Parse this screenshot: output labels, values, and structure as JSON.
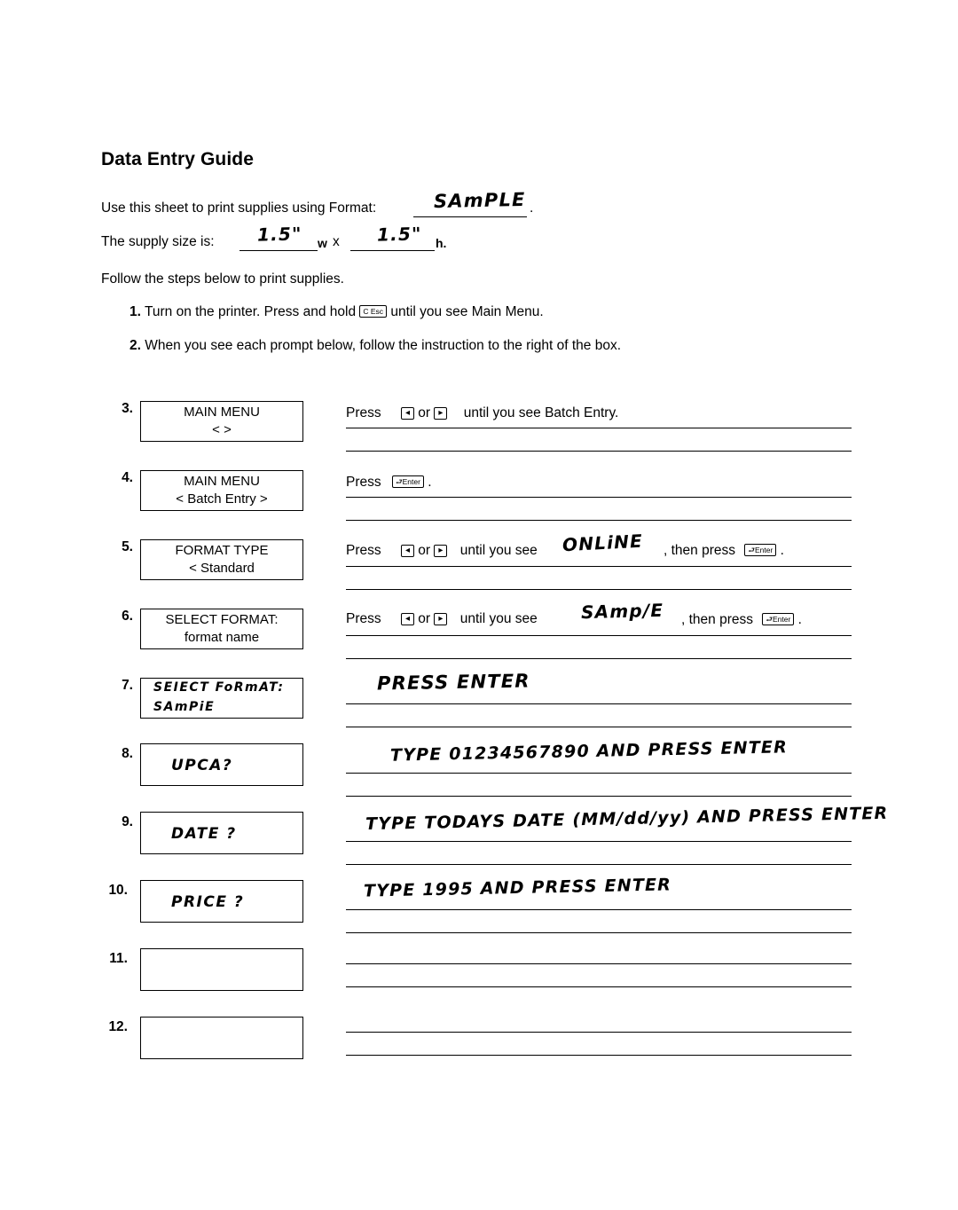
{
  "document": {
    "title": "Data Entry Guide",
    "intro": {
      "line1_prefix": "Use this sheet to print supplies using Format:",
      "line1_handwritten": "SAmPLE",
      "line1_suffix": ".",
      "line2_prefix": "The supply size is:",
      "line2_width_handwritten": "1.5\"",
      "line2_w_label": "w",
      "line2_x": "x",
      "line2_height_handwritten": "1.5\"",
      "line2_h_label": "h.",
      "line3": "Follow the steps below to print supplies.",
      "step1_num": "1.",
      "step1_text_before": "Turn on the printer.  Press and hold",
      "step1_key": "C Esc",
      "step1_text_after": "until you see Main Menu.",
      "step2_num": "2.",
      "step2_text": "When you see each prompt below, follow the instruction to the right of the box."
    },
    "keys": {
      "left_arrow": "◂",
      "right_arrow": "▸",
      "enter": "⮐Enter"
    },
    "steps": [
      {
        "num": "3.",
        "lcd_line1": "MAIN MENU",
        "lcd_line2": "<                     >",
        "lcd_hand": false,
        "instr_parts": [
          "Press",
          "KEY_LEFT",
          "or",
          "KEY_RIGHT",
          "until you see Batch Entry."
        ],
        "instr_plain": "Press  ◂  or  ▸   until you see Batch Entry."
      },
      {
        "num": "4.",
        "lcd_line1": "MAIN  MENU",
        "lcd_line2": "<   Batch Entry   >",
        "lcd_hand": false,
        "instr_plain": "Press  ⮐Enter ."
      },
      {
        "num": "5.",
        "lcd_line1": "FORMAT TYPE",
        "lcd_line2": "<  Standard",
        "lcd_hand": false,
        "instr_plain": "Press  ◂  or  ▸  until you see",
        "instr_hand": "ONLiNE",
        "instr_tail": ", then press  ⮐Enter ."
      },
      {
        "num": "6.",
        "lcd_line1": "SELECT FORMAT:",
        "lcd_line2": "format name",
        "lcd_hand": false,
        "instr_plain": "Press  ◂  or  ▸  until you see",
        "instr_hand": "SAmp/E",
        "instr_tail": ", then press  ⮐Enter ."
      },
      {
        "num": "7.",
        "lcd_line1": "SEIECT FoRmAT:",
        "lcd_line2": "SAmPiE",
        "lcd_hand": true,
        "instr_hand_full": "PRESS  ENTER"
      },
      {
        "num": "8.",
        "lcd_line1": "",
        "lcd_line2": "UPCA?",
        "lcd_hand": true,
        "instr_hand_full": "TYPE   01234567890  AND  PRESS  ENTER"
      },
      {
        "num": "9.",
        "lcd_line1": "",
        "lcd_line2": "DATE ?",
        "lcd_hand": true,
        "instr_hand_full": "TYPE   TODAYS  DATE  (MM/dd/yy)  AND  PRESS  ENTER"
      },
      {
        "num": "10.",
        "lcd_line1": "",
        "lcd_line2": "PRICE ?",
        "lcd_hand": true,
        "instr_hand_full": "TYPE   1995  AND  PRESS  ENTER"
      },
      {
        "num": "11.",
        "lcd_line1": "",
        "lcd_line2": "",
        "lcd_hand": false,
        "instr_hand_full": ""
      },
      {
        "num": "12.",
        "lcd_line1": "",
        "lcd_line2": "",
        "lcd_hand": false,
        "instr_hand_full": ""
      }
    ]
  }
}
